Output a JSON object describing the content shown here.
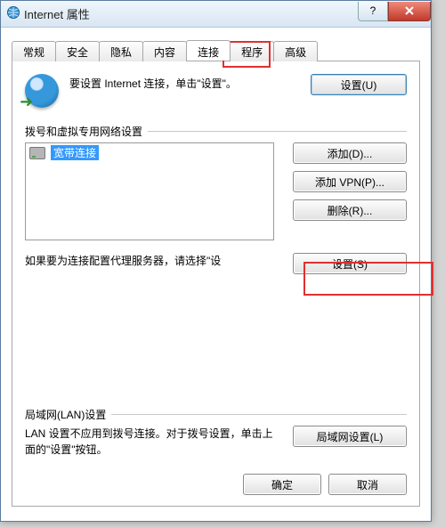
{
  "window": {
    "title": "Internet 属性"
  },
  "tabs": [
    "常规",
    "安全",
    "隐私",
    "内容",
    "连接",
    "程序",
    "高级"
  ],
  "active_tab_index": 4,
  "intro": {
    "text": "要设置 Internet 连接，单击\"设置\"。",
    "setup_button": "设置(U)"
  },
  "dial": {
    "group_label": "拨号和虚拟专用网络设置",
    "connections": [
      {
        "name": "宽带连接",
        "selected": true
      }
    ],
    "add_button": "添加(D)...",
    "add_vpn_button": "添加 VPN(P)...",
    "remove_button": "删除(R)..."
  },
  "proxy": {
    "text": "如果要为连接配置代理服务器，请选择\"设",
    "settings_button": "设置(S)"
  },
  "lan": {
    "group_label": "局域网(LAN)设置",
    "text": "LAN 设置不应用到拨号连接。对于拨号设置，单击上面的\"设置\"按钮。",
    "button": "局域网设置(L)"
  },
  "bottom": {
    "ok": "确定",
    "cancel": "取消"
  },
  "titlebar_buttons": {
    "help": "?",
    "close": "x"
  }
}
